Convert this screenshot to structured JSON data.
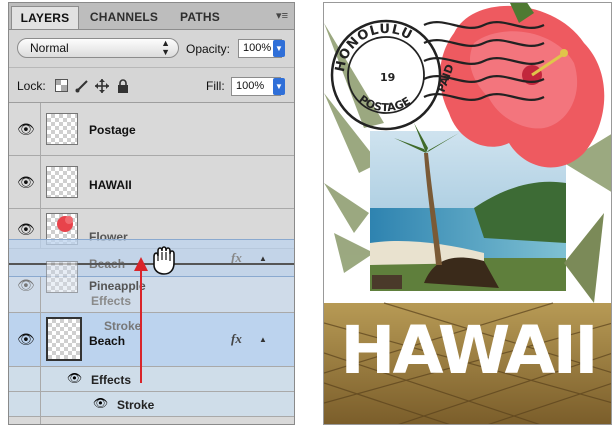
{
  "tabs": [
    "LAYERS",
    "CHANNELS",
    "PATHS"
  ],
  "blend_mode": "Normal",
  "opacity_label": "Opacity:",
  "opacity_value": "100%",
  "lock_label": "Lock:",
  "fill_label": "Fill:",
  "fill_value": "100%",
  "layers": [
    {
      "name": "Postage"
    },
    {
      "name": "HAWAII"
    },
    {
      "name": "Flower"
    },
    {
      "name": "Pineapple"
    },
    {
      "name": "Beach",
      "fx": "fx",
      "effects_label": "Effects",
      "stroke_label": "Stroke"
    }
  ],
  "drag_ghost": {
    "name": "Beach",
    "fx": "fx",
    "effects_label": "Effects",
    "stroke_label": "Stroke"
  },
  "poster": {
    "title": "HAWAII",
    "stamp_line_top": "HONOLULU",
    "stamp_line_right": "PAID",
    "stamp_line_bottom": "POSTAGE",
    "stamp_number": "19"
  },
  "colors": {
    "selection": "#bcd3ee",
    "arrow": "#d9242a"
  },
  "icons": [
    "panel-menu-icon",
    "eye-icon",
    "lock-transparent-icon",
    "lock-brush-icon",
    "lock-move-icon",
    "lock-all-icon",
    "grab-hand-cursor-icon"
  ]
}
